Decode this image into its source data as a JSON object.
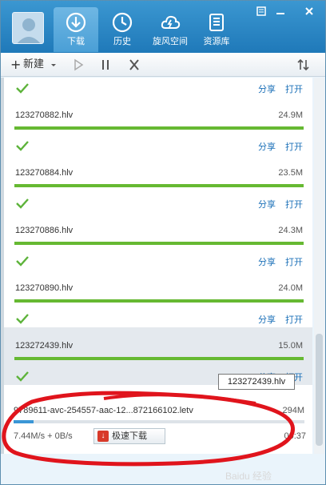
{
  "nav": {
    "tabs": [
      {
        "label": "下载",
        "icon": "download-icon"
      },
      {
        "label": "历史",
        "icon": "clock-icon"
      },
      {
        "label": "旋风空间",
        "icon": "cloud-icon"
      },
      {
        "label": "资源库",
        "icon": "library-icon"
      }
    ]
  },
  "toolbar": {
    "new_label": "新建",
    "new_prefix": "+"
  },
  "completed": {
    "share_label": "分享",
    "open_label": "打开",
    "items": [
      {
        "name": "123270882.hlv",
        "size": "24.9M",
        "progress": 1.0
      },
      {
        "name": "123270884.hlv",
        "size": "23.5M",
        "progress": 1.0
      },
      {
        "name": "123270886.hlv",
        "size": "24.3M",
        "progress": 1.0
      },
      {
        "name": "123270890.hlv",
        "size": "24.0M",
        "progress": 1.0
      },
      {
        "name": "123272439.hlv",
        "size": "15.0M",
        "progress": 1.0
      }
    ]
  },
  "active": {
    "name": "9789611-avc-254557-aac-12...872166102.letv",
    "size": "294M",
    "progress": 0.07,
    "speed": "7.44M/s + 0B/s",
    "turbo_label": "极速下载",
    "eta": "00:37"
  },
  "tooltip": {
    "text": "123272439.hlv"
  },
  "watermark": {
    "text": "Baidu 经验"
  },
  "colors": {
    "header": "#2a88c8",
    "complete_bar": "#66b932",
    "active_bar": "#3a96d6",
    "link": "#1b70b8",
    "annotation": "#e0141c"
  }
}
